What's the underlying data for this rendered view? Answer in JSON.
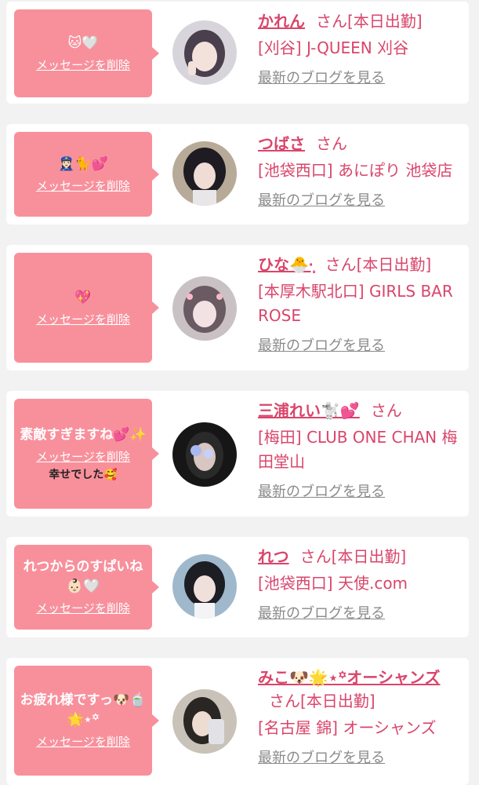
{
  "items": [
    {
      "message": "🐱🤍",
      "delete_label": "メッセージを削除",
      "extra": "",
      "name": "かれん",
      "honorific": "さん",
      "status": "[本日出勤]",
      "shop": "[刈谷] J-QUEEN 刈谷",
      "blog_label": "最新のブログを見る"
    },
    {
      "message": "👮🏻‍♀️🐈💕",
      "delete_label": "メッセージを削除",
      "extra": "",
      "name": "つばさ",
      "honorific": "さん",
      "status": "",
      "shop": "[池袋西口] あにぽり 池袋店",
      "blog_label": "最新のブログを見る"
    },
    {
      "message": "💖",
      "delete_label": "メッセージを削除",
      "extra": "",
      "name": "ひな🐣·̩͙",
      "honorific": "さん",
      "status": "[本日出勤]",
      "shop": "[本厚木駅北口] GIRLS BAR ROSE",
      "blog_label": "最新のブログを見る"
    },
    {
      "message": "素敵すぎますね💕✨",
      "delete_label": "メッセージを削除",
      "extra": "幸せでした🥰",
      "name": "三浦れい🐩💕",
      "honorific": "さん",
      "status": "",
      "shop": "[梅田] CLUB ONE CHAN 梅田堂山",
      "blog_label": "最新のブログを見る"
    },
    {
      "message": "れつからのすぱいね👶🏻🤍",
      "delete_label": "メッセージを削除",
      "extra": "",
      "name": "れつ",
      "honorific": "さん",
      "status": "[本日出勤]",
      "shop": "[池袋西口] 天使.com",
      "blog_label": "最新のブログを見る"
    },
    {
      "message": "お疲れ様ですっ🐶🍵🌟⋆꙳",
      "delete_label": "メッセージを削除",
      "extra": "",
      "name": "みこ🐶🌟⋆꙳オーシャンズ",
      "honorific": "さん",
      "status": "[本日出勤]",
      "shop": "[名古屋 錦] オーシャンズ",
      "blog_label": "最新のブログを見る"
    }
  ]
}
